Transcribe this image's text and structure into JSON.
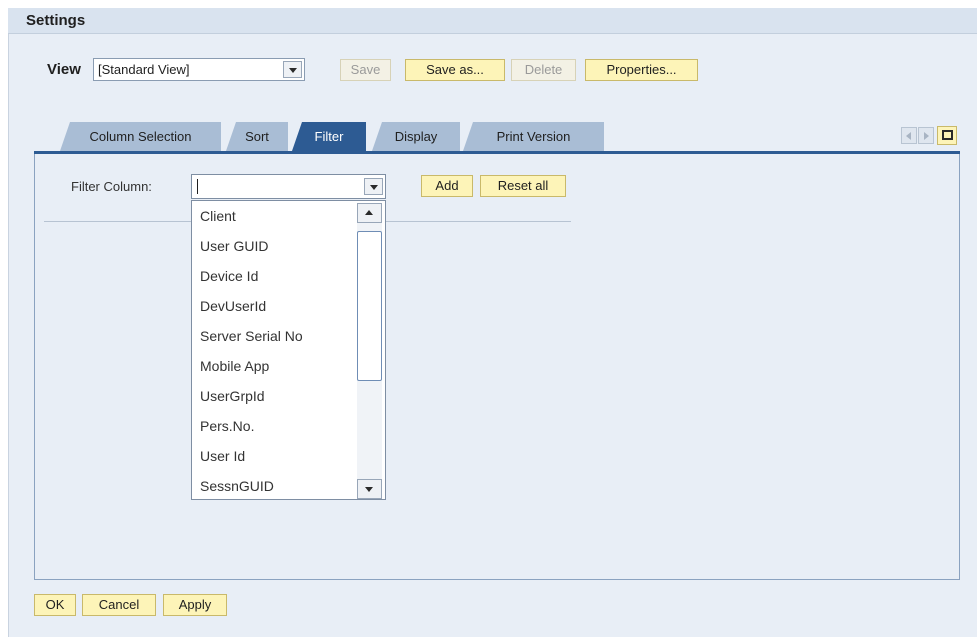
{
  "window": {
    "title": "Settings"
  },
  "view": {
    "label": "View",
    "selected": "[Standard View]",
    "buttons": {
      "save": "Save",
      "save_as": "Save as...",
      "delete": "Delete",
      "properties": "Properties..."
    }
  },
  "tabs": [
    {
      "label": "Column Selection",
      "active": false
    },
    {
      "label": "Sort",
      "active": false
    },
    {
      "label": "Filter",
      "active": true
    },
    {
      "label": "Display",
      "active": false
    },
    {
      "label": "Print Version",
      "active": false
    }
  ],
  "tab_nav": {
    "prev_icon": "arrow-left-icon",
    "next_icon": "arrow-right-icon",
    "list_icon": "tab-list-icon"
  },
  "filter": {
    "label": "Filter Column:",
    "value": "",
    "add": "Add",
    "reset_all": "Reset all",
    "options": [
      "Client",
      "User GUID",
      "Device Id",
      "DevUserId",
      "Server Serial No",
      "Mobile App",
      "UserGrpId",
      "Pers.No.",
      "User Id",
      "SessnGUID"
    ]
  },
  "footer": {
    "ok": "OK",
    "cancel": "Cancel",
    "apply": "Apply"
  },
  "colors": {
    "accent": "#2d5b93",
    "button_bg": "#fdf4b8",
    "panel_bg": "#e8eef6",
    "tab_bg": "#a9bdd5"
  }
}
